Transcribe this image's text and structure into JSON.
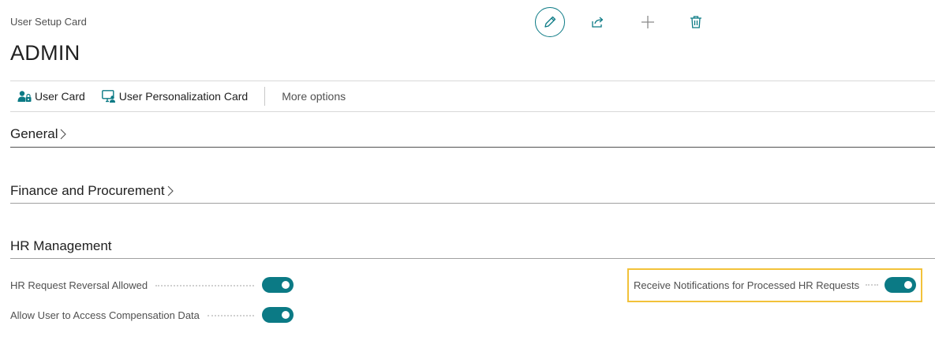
{
  "header": {
    "caption": "User Setup Card",
    "title": "ADMIN",
    "actions": [
      {
        "name": "edit-icon"
      },
      {
        "name": "share-icon"
      },
      {
        "name": "add-icon"
      },
      {
        "name": "delete-icon"
      }
    ],
    "accent_color": "#0b7a85"
  },
  "actionbar": {
    "user_card": "User Card",
    "user_personalization_card": "User Personalization Card",
    "more_options": "More options"
  },
  "sections": {
    "general": "General",
    "finance": "Finance and Procurement",
    "hr": "HR Management"
  },
  "hr_fields": {
    "reversal_allowed": {
      "label": "HR Request Reversal Allowed",
      "value": true
    },
    "compensation_access": {
      "label": "Allow User to Access Compensation Data",
      "value": true
    },
    "receive_notifications": {
      "label": "Receive Notifications for Processed HR Requests",
      "value": true
    }
  },
  "highlight_color": "#f2c23a"
}
